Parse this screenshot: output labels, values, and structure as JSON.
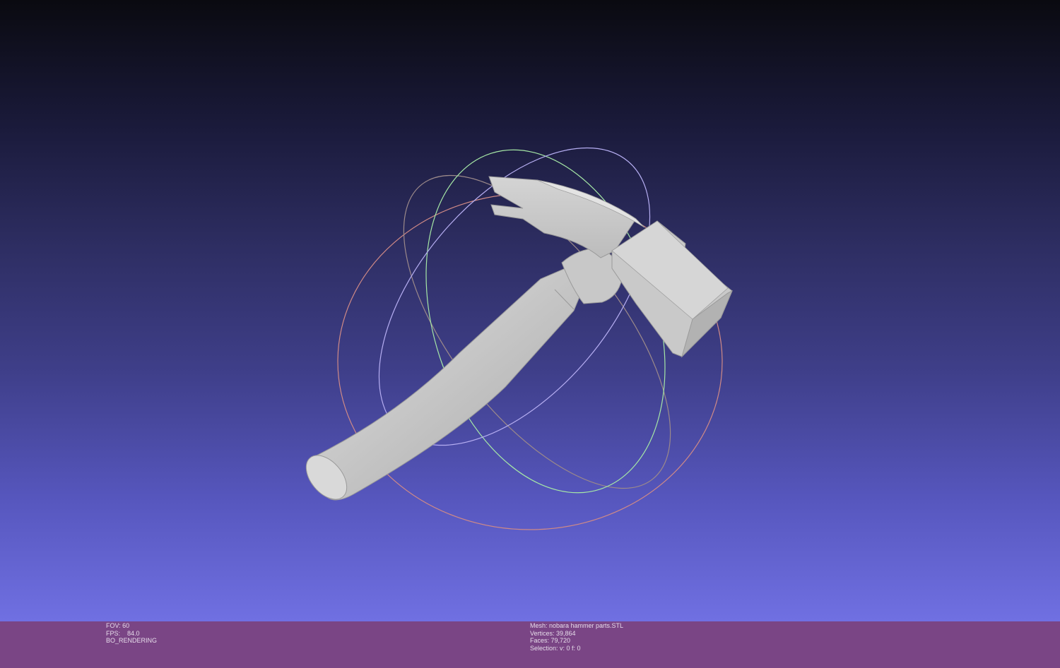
{
  "colors": {
    "background_top": "#0a0a10",
    "background_bottom": "#7070e2",
    "statusbar": "#7a4585",
    "mesh": "#cfcfcf",
    "trackball_x": "#e0907a",
    "trackball_y": "#a6e8a6",
    "trackball_z": "#b0a8f0"
  },
  "viewport": {
    "mesh_icon": "hammer-mesh"
  },
  "render_info": {
    "fov": "FOV: 60",
    "fps": "FPS:    84.0",
    "mode": "BO_RENDERING"
  },
  "mesh_info": {
    "mesh": "Mesh: nobara hammer parts.STL",
    "vertices": "Vertices: 39,864",
    "faces": "Faces: 79,720",
    "selection": "Selection: v: 0 f: 0"
  }
}
